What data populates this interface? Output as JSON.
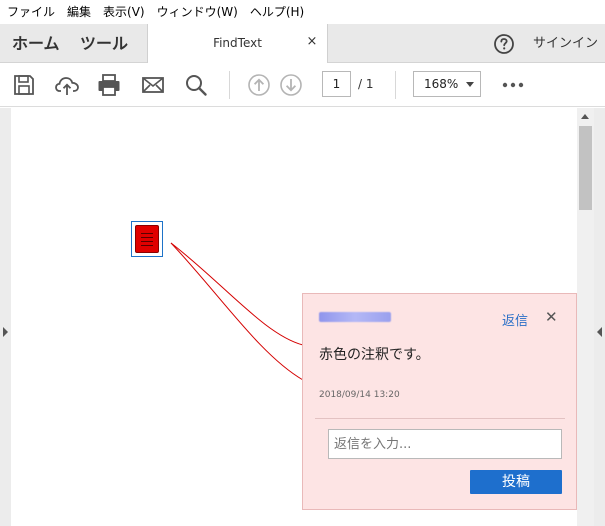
{
  "menu": {
    "items": [
      "ファイル",
      "編集",
      "表示(V)",
      "ウィンドウ(W)",
      "ヘルプ(H)"
    ]
  },
  "tabs": {
    "home": "ホーム",
    "tools": "ツール",
    "document": "FindText",
    "close_glyph": "×",
    "signin": "サインイン"
  },
  "toolbar": {
    "page_current": "1",
    "page_total": "/ 1",
    "zoom": "168%"
  },
  "icons": {
    "save": "save-icon",
    "upload": "cloud-upload-icon",
    "print": "print-icon",
    "mail": "mail-icon",
    "search": "search-icon",
    "prev": "arrow-up-icon",
    "next": "arrow-down-icon",
    "more": "more-icon",
    "help": "help-icon",
    "note": "sticky-note-icon"
  },
  "comment_popup": {
    "reply_label": "返信",
    "close_glyph": "✕",
    "text": "赤色の注釈です。",
    "date": "2018/09/14  13:20",
    "reply_placeholder": "返信を入力...",
    "post_label": "投稿"
  },
  "colors": {
    "annotation": "#e00000",
    "popup_bg": "#fde4e4",
    "accent": "#1e6fcd"
  }
}
